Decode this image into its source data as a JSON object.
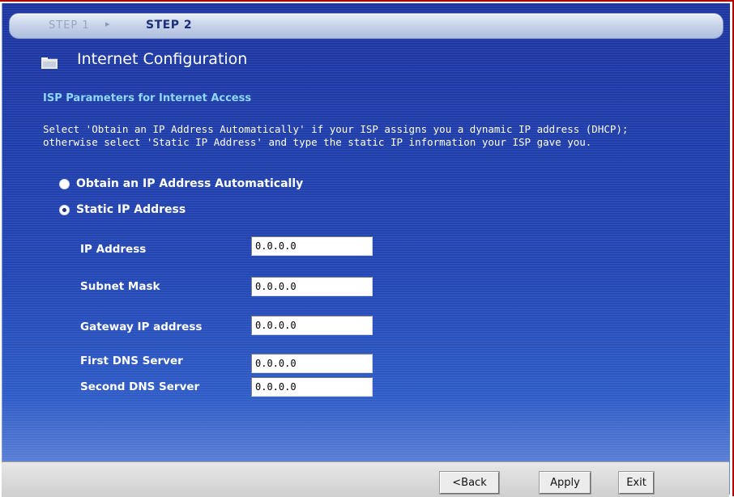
{
  "steps": {
    "step1_label": "STEP 1",
    "separator": "▸",
    "step2_label": "STEP 2"
  },
  "page": {
    "title": "Internet Configuration",
    "icon": "folder-icon"
  },
  "section": {
    "heading": "ISP Parameters for Internet Access",
    "description_line1": "Select 'Obtain an IP Address Automatically' if your ISP assigns you a dynamic IP address (DHCP);",
    "description_line2": "otherwise select 'Static IP Address' and type the static IP information your ISP gave you."
  },
  "ip_mode": {
    "options": [
      {
        "label": "Obtain an IP Address Automatically",
        "selected": false
      },
      {
        "label": "Static IP Address",
        "selected": true
      }
    ]
  },
  "fields": [
    {
      "label": "IP Address",
      "value": "0.0.0.0"
    },
    {
      "label": "Subnet Mask",
      "value": "0.0.0.0"
    },
    {
      "label": "Gateway IP address",
      "value": "0.0.0.0"
    },
    {
      "label": "First DNS Server",
      "value": "0.0.0.0"
    },
    {
      "label": "Second DNS Server",
      "value": "0.0.0.0"
    }
  ],
  "buttons": {
    "back": "<Back",
    "apply": "Apply",
    "exit": "Exit"
  },
  "colors": {
    "panel_blue": "#1f3fa6",
    "heading_cyan": "#8fd7ff",
    "frame_red": "#b00000"
  }
}
